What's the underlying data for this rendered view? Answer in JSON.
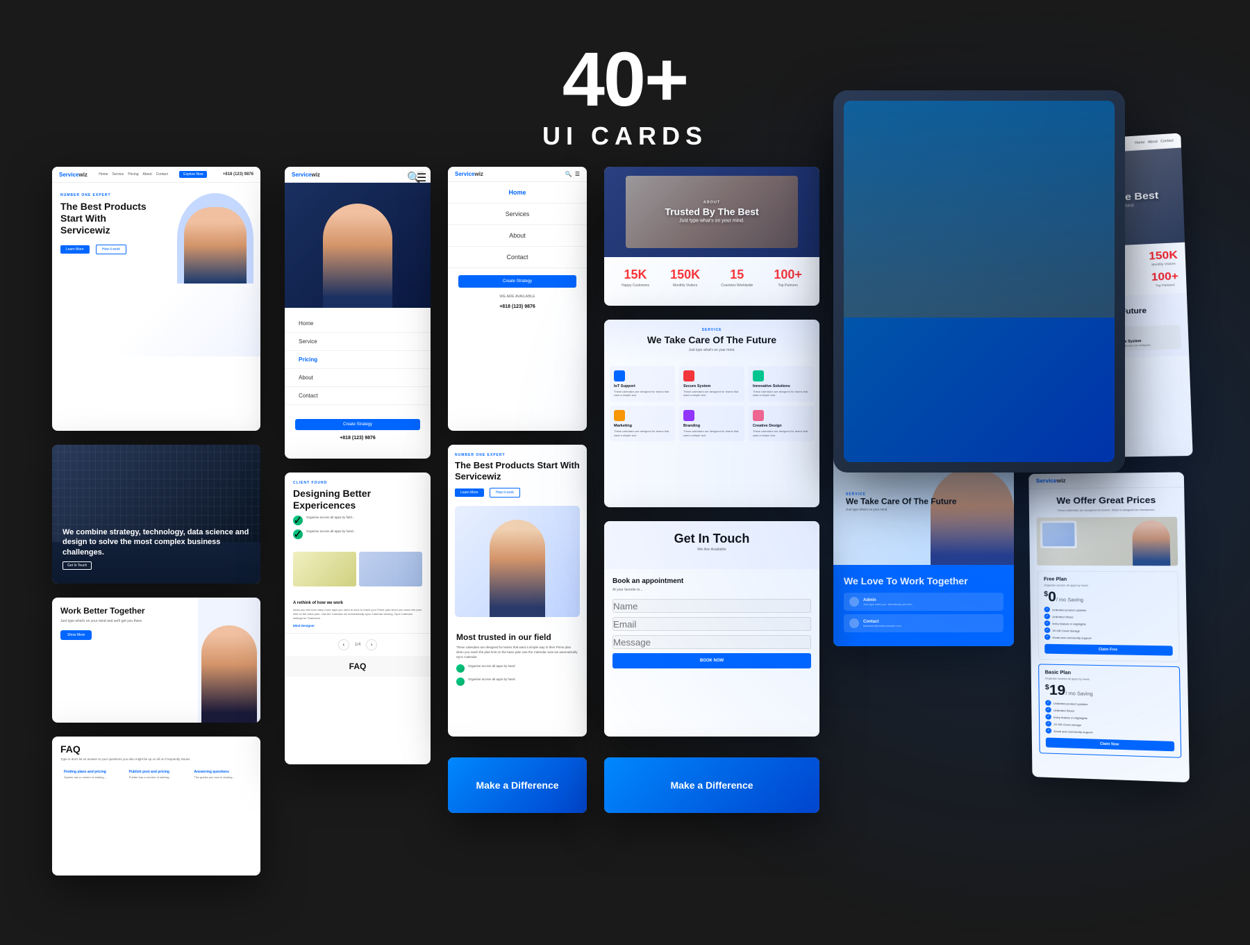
{
  "header": {
    "count": "40+",
    "subtitle": "UI CARDS"
  },
  "cards": {
    "card1": {
      "tag": "NUMBER ONE EXPERT",
      "title": "The Best Products Start With Servicewiz",
      "btn1": "Learn More",
      "btn2": "How it work",
      "phone": "+818 (123) 9876"
    },
    "card2": {
      "text": "We combine strategy, technology, data science and design to solve the most complex business challenges.",
      "btn": "Get In Touch"
    },
    "card3": {
      "title": "Work Better Together",
      "text": "Just type what's on your mind and we'll get you there.",
      "btn": "Show More"
    },
    "card4": {
      "title": "FAQ",
      "subtitle": "Type in don't let us answer to your questions you also might be up on all on Frequently Issues",
      "items": [
        {
          "q": "Finding plans and pricing",
          "a": "System has a number of starting..."
        },
        {
          "q": "Publish post and pricing",
          "a": "Publish has a number of starting..."
        },
        {
          "q": "Answering and services",
          "a": "This guides you how to starting..."
        }
      ]
    },
    "card5": {
      "logo": "Servicewiz",
      "menu_items": [
        "Home",
        "Service",
        "Pricing",
        "About",
        "Contact"
      ],
      "active": "Pricing",
      "cta": "Create Strategy",
      "phone": "+818 (123) 9876"
    },
    "card6": {
      "tag": "CLIENT FOUND",
      "title": "Designing Better Expericences",
      "feature1": "Organise access all apps by field...",
      "feature2": "Organise access all apps by hand..."
    },
    "card7": {
      "menu_items": [
        "Home",
        "Services",
        "About",
        "Contact"
      ],
      "cta": "Create Strategy",
      "phone": "+818 (123) 9876"
    },
    "card8": {
      "tag": "NUMBER ONE EXPERT",
      "title": "The Best Products Start With Servicewiz",
      "btn1": "Learn More",
      "btn2": "How it work"
    },
    "card9": {
      "title": "Trusted By The Best",
      "subtitle": "Just type what's on your mind."
    },
    "card10": {
      "tag": "SERVICE",
      "title": "We Take Care Of The Future",
      "subtitle": "Just type what's on your mind.",
      "services": [
        {
          "title": "IoT Support",
          "text": "These calendars are designed for teams that want a simple tool to plan their work."
        },
        {
          "title": "Secure System",
          "text": "These calendars are designed for teams that want a simple tool to plan their work."
        },
        {
          "title": "Innovative Solutions",
          "text": "These calendars are designed for teams that want a simple tool to plan their work."
        },
        {
          "title": "Marketing",
          "text": "These calendars are designed for teams that want a simple tool to plan their work."
        },
        {
          "title": "Branding",
          "text": "These calendars are designed for teams that want a simple tool to plan their work."
        },
        {
          "title": "Creative Design",
          "text": "These calendars are designed for teams that want a simple tool to plan their work."
        }
      ]
    },
    "card11": {
      "title": "Get In Touch",
      "subtitle": "We Are Available",
      "form_title": "Book an appointment",
      "form_sub": "At your favorite m...",
      "btn": "BOOK NOW"
    },
    "card12": {
      "title": "Get In Touch",
      "subtitle": "We Are Available",
      "form_title": "Book an appointment",
      "form_sub": "At your favorite m...",
      "btn": "BOOK NOW"
    },
    "card13": {
      "title": "We Love To Work Together",
      "admin": "Admin",
      "admin_text": "Just type what you. Wordlessly yes this...",
      "contact": "Contact",
      "contact_email": "firstname@email.example.com"
    },
    "card14": {
      "title": "Trusted By The Best",
      "subtitle": "Just type what's on your mind.",
      "stats": [
        {
          "num": "15K",
          "label": "Happy Customers"
        },
        {
          "num": "150K",
          "label": "Monthly Visitors"
        },
        {
          "num": "15",
          "label": "Countries Worldwide"
        },
        {
          "num": "100+",
          "label": "Top Partners"
        }
      ]
    },
    "card15": {
      "title": "We Offer Great Prices",
      "text": "These calendars are designed for teams. Slicle is designed for freelancers.",
      "plans": [
        {
          "name": "Free Plan",
          "desc": "Organise access all apps by hand.",
          "price": "0",
          "currency": "$",
          "period": "/ mo Saving",
          "features": [
            "Unlimited product updates",
            "Unlimited Slices",
            "Entry feature in Highlights",
            "20 GB Cloud storage",
            "Email and community support"
          ],
          "btn": "Claim Free"
        },
        {
          "name": "Basic Plan",
          "desc": "Organise access all apps by hand.",
          "price": "19",
          "currency": "$",
          "period": "/ mo Saving",
          "features": [
            "Unlimited product updates",
            "Unlimited Slices",
            "Entry feature in Highlights",
            "20 GB Cloud storage",
            "Email and community support"
          ],
          "btn": "Claim Now"
        }
      ]
    },
    "bottom1": {
      "title": "Make a Difference"
    },
    "bottom2": {
      "title": "Make a Difference"
    }
  },
  "most_trusted": {
    "title": "Most trusted in our field",
    "text": "These calendars are designed for teams that want a simple way to their Prime plan when you reach the plan limit on the basic plan Use the Calendar view we automatically Sync Calendar.",
    "feature1": "Organise access all apps by hand",
    "feature2": "Organise access all apps by hand"
  },
  "logo": {
    "text_blue": "Service",
    "text_dark": "wiz"
  }
}
